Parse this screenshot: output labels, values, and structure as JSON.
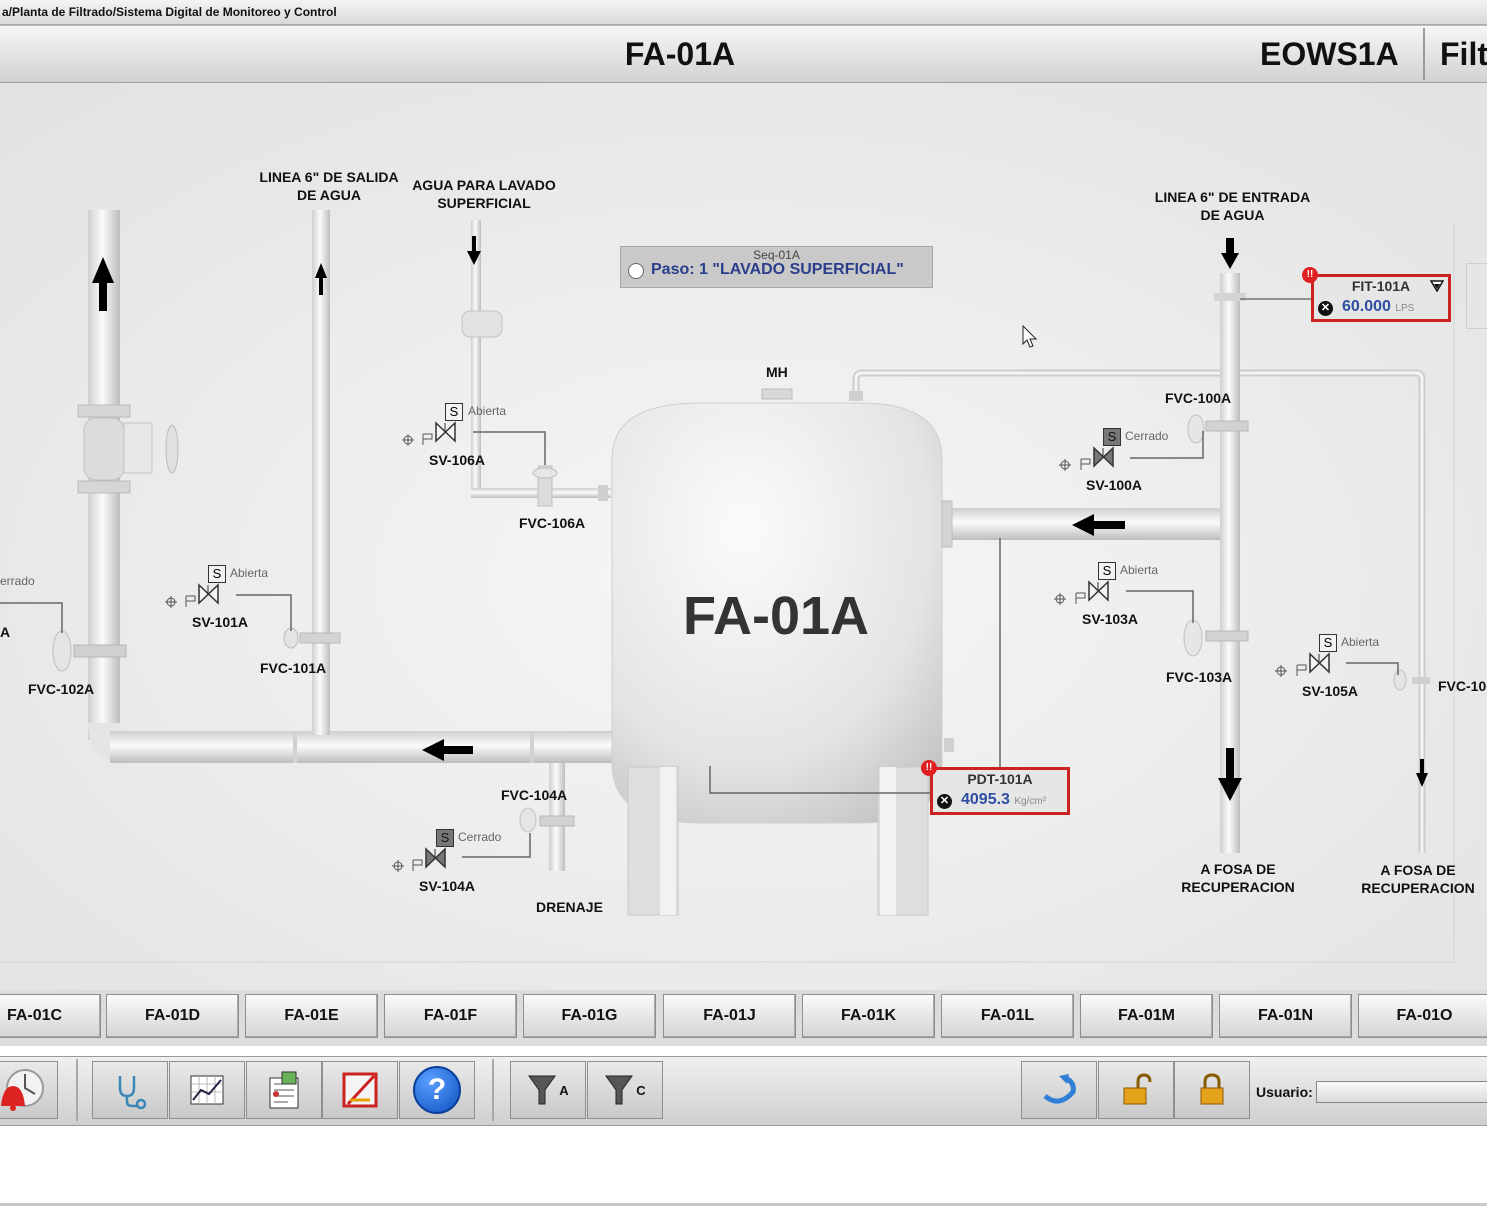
{
  "header": {
    "breadcrumb": "a/Planta de Filtrado/Sistema Digital de Monitoreo y Control",
    "title": "FA-01A",
    "station": "EOWS1A",
    "title_truncated": "Filt"
  },
  "diagram": {
    "vessel_label": "FA-01A",
    "manhole_label": "MH",
    "labels": {
      "outlet_line": "LINEA 6\" DE SALIDA\nDE AGUA",
      "surface_wash": "AGUA PARA LAVADO\nSUPERFICIAL",
      "inlet_line": "LINEA 6\" DE ENTRADA\nDE AGUA",
      "recovery_pit_1": "A  FOSA DE\nRECUPERACION",
      "recovery_pit_2": "A  FOSA DE\nRECUPERACION",
      "drain": "DRENAJE"
    },
    "valves": {
      "fvc_100a": "FVC-100A",
      "fvc_101a": "FVC-101A",
      "fvc_102a": "FVC-102A",
      "fvc_103a": "FVC-103A",
      "fvc_104a": "FVC-104A",
      "fvc_106a": "FVC-106A",
      "fvc_105_trunc": "FVC-10"
    },
    "solenoids": {
      "sv_100a": {
        "tag": "SV-100A",
        "state": "Cerrado"
      },
      "sv_101a": {
        "tag": "SV-101A",
        "state": "Abierta"
      },
      "sv_103a": {
        "tag": "SV-103A",
        "state": "Abierta"
      },
      "sv_104a": {
        "tag": "SV-104A",
        "state": "Cerrado"
      },
      "sv_105a": {
        "tag": "SV-105A",
        "state": "Abierta"
      },
      "sv_106a": {
        "tag": "SV-106A",
        "state": "Abierta"
      },
      "sv_102a_state_trunc": "errado",
      "sv_102a_tag_trunc": "A",
      "s_letter": "S"
    },
    "sequence": {
      "id": "Seq-01A",
      "step": "Paso: 1  \"LAVADO SUPERFICIAL\""
    },
    "instruments": {
      "fit_101a": {
        "tag": "FIT-101A",
        "value": "60.000",
        "unit": "LPS"
      },
      "pdt_101a": {
        "tag": "PDT-101A",
        "value": "4095.3",
        "unit": "Kg/cm²"
      }
    }
  },
  "nav_tabs": [
    "FA-01C",
    "FA-01D",
    "FA-01E",
    "FA-01F",
    "FA-01G",
    "FA-01J",
    "FA-01K",
    "FA-01L",
    "FA-01M",
    "FA-01N",
    "FA-01O"
  ],
  "toolbar": {
    "icons": [
      "alarm-bell-icon",
      "stethoscope-icon",
      "trend-chart-icon",
      "report-icon",
      "no-sign-icon",
      "help-icon",
      "filter-a-icon",
      "filter-c-icon",
      "refresh-icon",
      "unlock-icon",
      "lock-icon"
    ],
    "filter_a_letter": "A",
    "filter_c_letter": "C",
    "help_glyph": "?",
    "user_label": "Usuario:",
    "user_value": ""
  },
  "colors": {
    "alarm_border": "#cc2222",
    "value_text": "#2e4ea1",
    "sequence_text": "#2b3e8c"
  }
}
